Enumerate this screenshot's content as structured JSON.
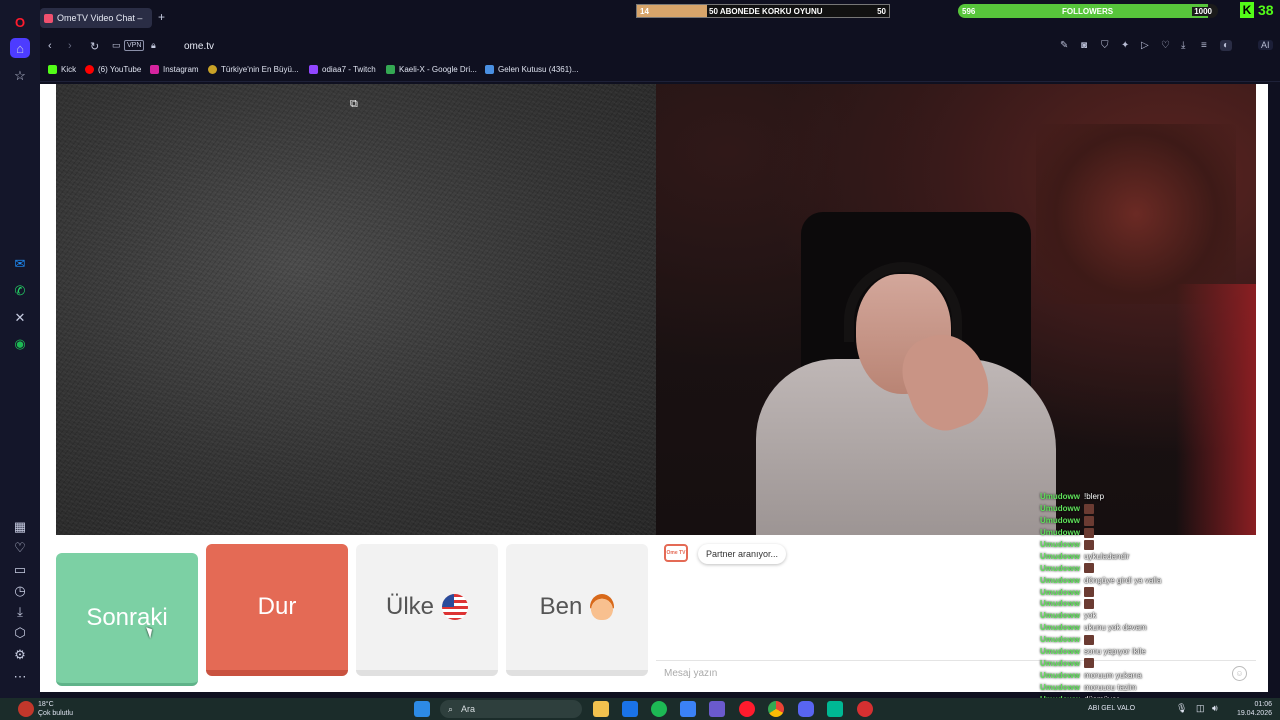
{
  "browser": {
    "tab_title": "OmeTV Video Chat –",
    "new_tab": "+",
    "url": "ome.tv",
    "vpn_label": "VPN"
  },
  "stream_overlay": {
    "goal_left_value": "14",
    "goal_title": "50 ABONEDE KORKU OYUNU",
    "goal_right_value": "50",
    "followers_current": "596",
    "followers_label": "FOLLOWERS",
    "followers_target": "1000",
    "kick_count": "38"
  },
  "bookmarks": [
    {
      "label": "Kick",
      "color": "#53fc18"
    },
    {
      "label": "(6) YouTube",
      "color": "#ff0000"
    },
    {
      "label": "Instagram",
      "color": "#d6249f"
    },
    {
      "label": "Türkiye'nin En Büyü...",
      "color": "#c9a227"
    },
    {
      "label": "odiaa7 - Twitch",
      "color": "#9146ff"
    },
    {
      "label": "Kaeli-X - Google Dri...",
      "color": "#34a853"
    },
    {
      "label": "Gelen Kutusu (4361)...",
      "color": "#4a90e2"
    }
  ],
  "controls": {
    "next_label": "Sonraki",
    "stop_label": "Dur",
    "country_label": "Ülke",
    "me_label": "Ben"
  },
  "chat": {
    "status_text": "Partner aranıyor...",
    "logo_text": "Ome TV",
    "input_placeholder": "Mesaj yazın"
  },
  "overlay_chat": [
    {
      "user": "Umudoww",
      "msg": "!blerp"
    },
    {
      "user": "Umudoww",
      "msg": ""
    },
    {
      "user": "Umudoww",
      "msg": ""
    },
    {
      "user": "Umudoww",
      "msg": ""
    },
    {
      "user": "Umudoww",
      "msg": ""
    },
    {
      "user": "Umudoww",
      "msg": "uykuladandir"
    },
    {
      "user": "Umudoww",
      "msg": ""
    },
    {
      "user": "Umudoww",
      "msg": "döngüye girdi ya valla"
    },
    {
      "user": "Umudoww",
      "msg": ""
    },
    {
      "user": "Umudoww",
      "msg": ""
    },
    {
      "user": "Umudoww",
      "msg": "yok"
    },
    {
      "user": "Umudoww",
      "msg": "ukunu yok devam"
    },
    {
      "user": "Umudoww",
      "msg": ""
    },
    {
      "user": "Umudoww",
      "msg": "sonu yapıyor ikile"
    },
    {
      "user": "Umudoww",
      "msg": ""
    },
    {
      "user": "Umudoww",
      "msg": "moruum yukarıa"
    },
    {
      "user": "Umudoww",
      "msg": "moruucu tazim"
    },
    {
      "user": "Umudoww",
      "msg": "düşmüyor"
    }
  ],
  "taskbar": {
    "weather_temp": "18°C",
    "weather_desc": "Çok bulutlu",
    "search_label": "Ara",
    "tray_text": "ABI GEL VALO",
    "time": "01:06",
    "date": "19.04.2026"
  }
}
